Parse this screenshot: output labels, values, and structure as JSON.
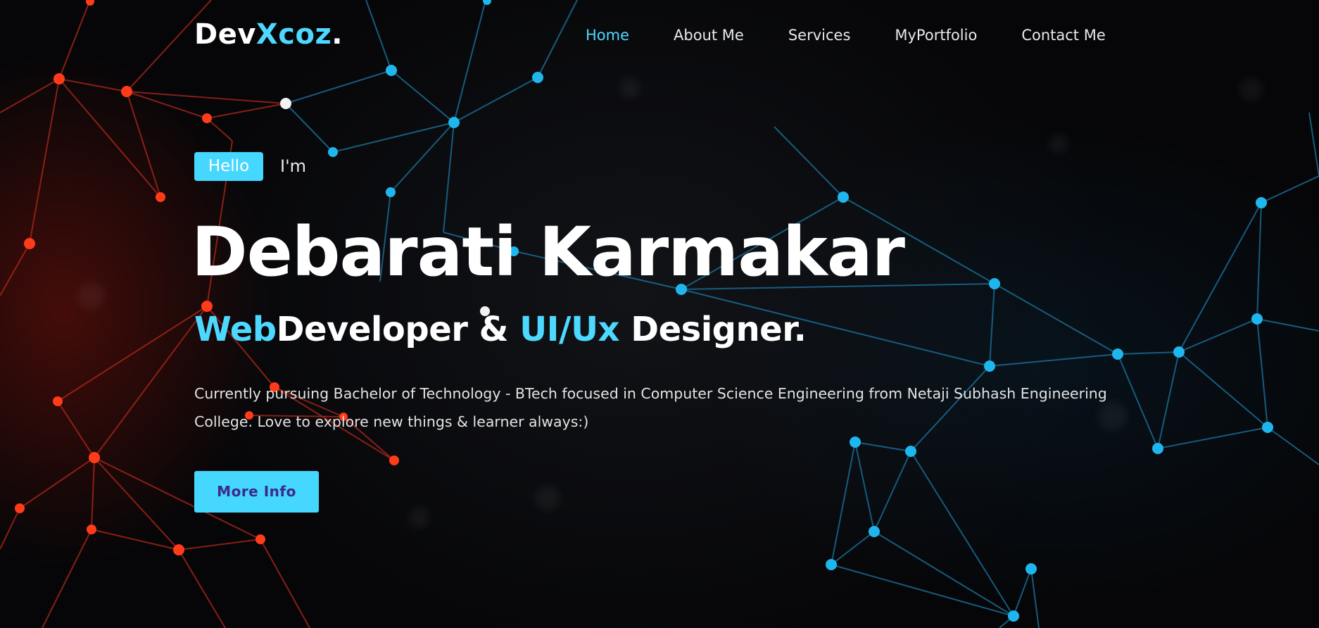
{
  "header": {
    "logo": {
      "part1": "Dev",
      "part2": "Xcoz",
      "part3": "."
    },
    "nav": [
      {
        "label": "Home",
        "active": true
      },
      {
        "label": "About Me",
        "active": false
      },
      {
        "label": "Services",
        "active": false
      },
      {
        "label": "MyPortfolio",
        "active": false
      },
      {
        "label": "Contact Me",
        "active": false
      }
    ]
  },
  "hero": {
    "badge": "Hello",
    "intro": "I'm",
    "name": "Debarati Karmakar",
    "role": {
      "part1": "Web",
      "part2": "Developer & ",
      "part3": "UI/Ux",
      "part4": " Designer."
    },
    "description": "Currently pursuing Bachelor of Technology - BTech focused in Computer Science Engineering from Netaji Subhash Engineering College. Love to explore new things & learner always:)",
    "button_label": "More Info"
  },
  "colors": {
    "accent": "#45d7fd",
    "button_text": "#3b2a8c",
    "background": "#060608",
    "network_red": "#ff3b1a",
    "network_blue": "#1fb6ee"
  }
}
